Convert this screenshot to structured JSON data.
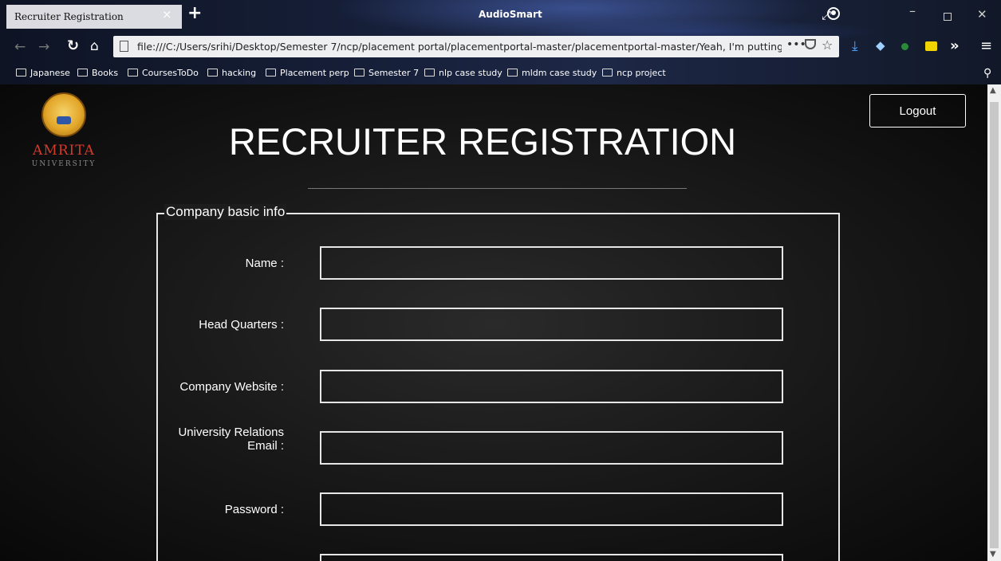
{
  "browser": {
    "tab_title": "Recruiter Registration",
    "tab_close": "×",
    "new_tab": "+",
    "window_title": "AudioSmart",
    "url": "file:///C:/Users/srihi/Desktop/Semester 7/ncp/placement portal/placementportal-master/placementportal-master/Yeah, I'm putting mc",
    "url_more": "•••",
    "bookmarks": [
      "Japanese",
      "Books",
      "CoursesToDo",
      "hacking",
      "Placement perp",
      "Semester 7",
      "nlp case study",
      "mldm case study",
      "ncp project"
    ]
  },
  "header": {
    "logo_name": "AMRITA",
    "logo_sub": "UNIVERSITY",
    "logout_label": "Logout",
    "title": "RECRUITER REGISTRATION"
  },
  "form": {
    "legend": "Company basic info",
    "fields": [
      {
        "label": "Name :",
        "value": ""
      },
      {
        "label": "Head Quarters :",
        "value": ""
      },
      {
        "label": "Company Website :",
        "value": ""
      },
      {
        "label": "University Relations Email :",
        "value": ""
      },
      {
        "label": "Password :",
        "value": ""
      },
      {
        "label": "",
        "value": ""
      }
    ]
  },
  "colors": {
    "accent_logo": "#d23a2a",
    "border": "#e6e6e6",
    "background": "#1a1a1a"
  }
}
